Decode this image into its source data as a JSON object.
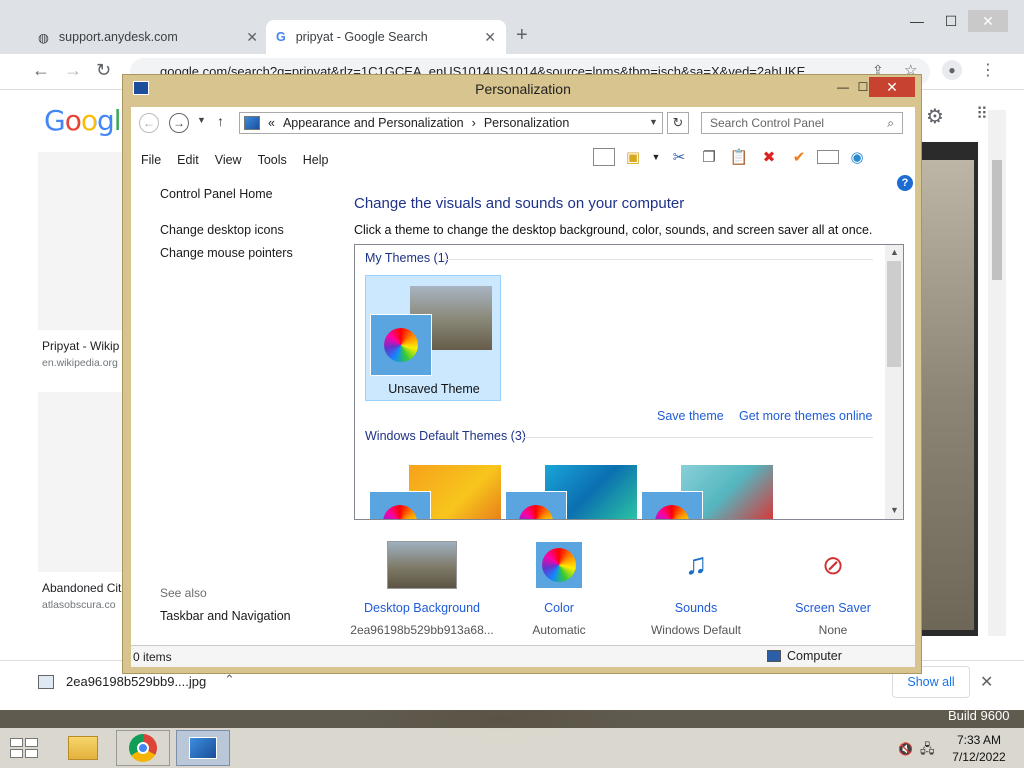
{
  "browser": {
    "tabs": [
      {
        "label": "support.anydesk.com",
        "active": false
      },
      {
        "label": "pripyat - Google Search",
        "active": true
      }
    ],
    "url": "google.com/search?q=pripyat&rlz=1C1GCEA_enUS1014US1014&source=lnms&tbm=isch&sa=X&ved=2ahUKE",
    "logo": "Google",
    "results": [
      {
        "title": "Pripyat - Wikip",
        "source": "en.wikipedia.org"
      },
      {
        "title": "Abandoned Cit",
        "source": "atlasobscura.co"
      }
    ],
    "download": {
      "filename": "2ea96198b529bb9....jpg",
      "show_all": "Show all"
    }
  },
  "window": {
    "title": "Personalization",
    "breadcrumb": {
      "prefix": "«",
      "items": [
        "Appearance and Personalization",
        "Personalization"
      ]
    },
    "search_placeholder": "Search Control Panel",
    "menu": [
      "File",
      "Edit",
      "View",
      "Tools",
      "Help"
    ],
    "sidebar": {
      "links": [
        "Control Panel Home",
        "Change desktop icons",
        "Change mouse pointers"
      ],
      "see_also_title": "See also",
      "see_also_links": [
        "Taskbar and Navigation"
      ]
    },
    "heading": "Change the visuals and sounds on your computer",
    "subheading": "Click a theme to change the desktop background, color, sounds, and screen saver all at once.",
    "my_themes": {
      "title": "My Themes (1)",
      "items": [
        {
          "label": "Unsaved Theme",
          "selected": true
        }
      ]
    },
    "links": {
      "save_theme": "Save theme",
      "get_more": "Get more themes online"
    },
    "default_themes": {
      "title": "Windows Default Themes (3)"
    },
    "bottom": [
      {
        "label": "Desktop Background",
        "value": "2ea96198b529bb913a68..."
      },
      {
        "label": "Color",
        "value": "Automatic"
      },
      {
        "label": "Sounds",
        "value": "Windows Default"
      },
      {
        "label": "Screen Saver",
        "value": "None"
      }
    ],
    "status_left": "0 items",
    "status_right": "Computer"
  },
  "taskbar": {
    "time": "7:33 AM",
    "date": "7/12/2022",
    "build": "Build 9600"
  },
  "colors": {
    "accent_link": "#1e5cd8",
    "heading": "#1e3287",
    "window_frame": "#d8c48e"
  }
}
